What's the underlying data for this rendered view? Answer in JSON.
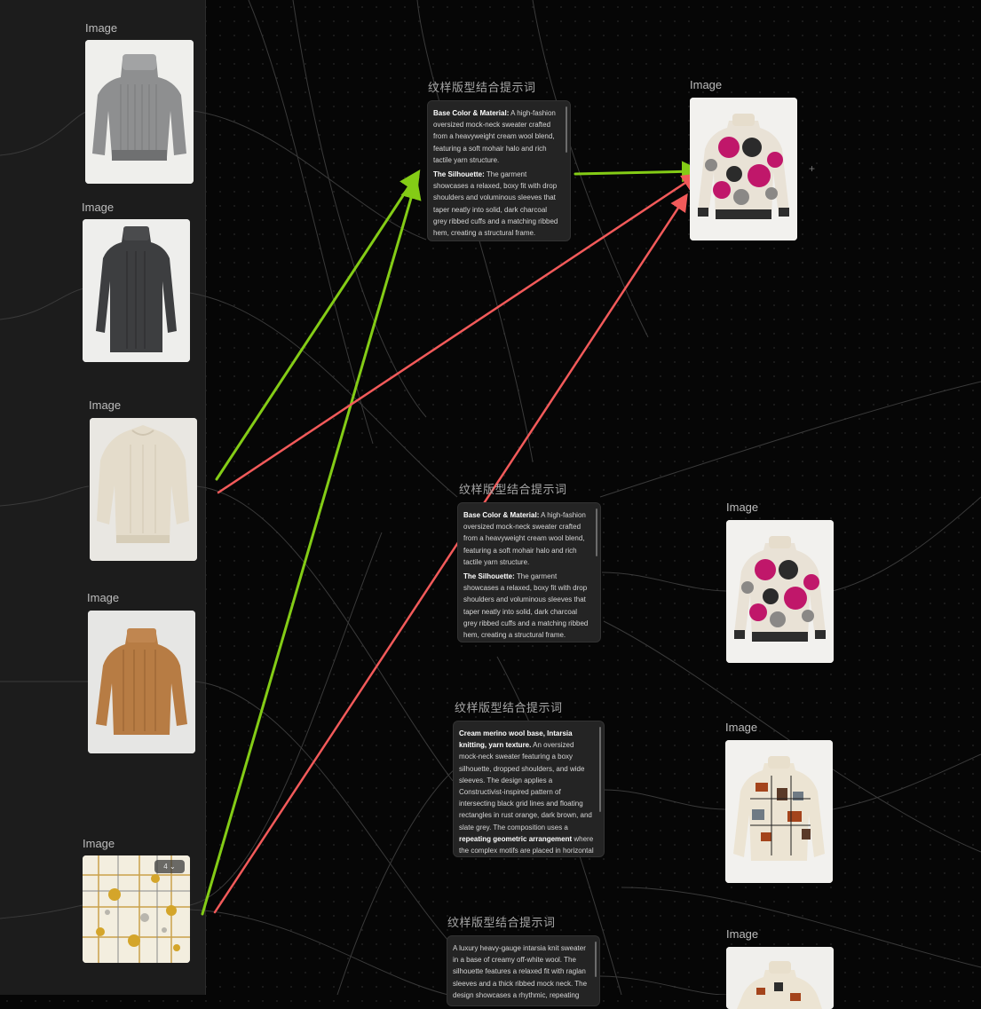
{
  "colors": {
    "canvas_bg": "#060606",
    "panel_bg": "#1c1c1c",
    "edge_gray": "#3a3a3a",
    "arrow_green": "#84cc16",
    "arrow_red": "#f25a5a",
    "accent_magenta": "#c0176a"
  },
  "left_images": [
    {
      "label": "Image",
      "subject": "gray chunky rib-knit turtleneck sweater"
    },
    {
      "label": "Image",
      "subject": "charcoal cable-knit sweater dress"
    },
    {
      "label": "Image",
      "subject": "cream oversized balloon-sleeve sweater"
    },
    {
      "label": "Image",
      "subject": "camel chunky knit mock-neck sweater"
    },
    {
      "label": "Image",
      "subject": "abstract geometric pattern swatch",
      "badge": "4"
    }
  ],
  "prompt_nodes": [
    {
      "label": "纹样版型结合提示词",
      "paragraphs": [
        {
          "bold": "Base Color & Material:",
          "text": " A high-fashion oversized mock-neck sweater crafted from a heavyweight cream wool blend, featuring a soft mohair halo and rich tactile yarn structure."
        },
        {
          "bold": "The Silhouette:",
          "text": " The garment showcases a relaxed, boxy fit with drop shoulders and voluminous sleeves that taper neatly into solid, dark charcoal grey ribbed cuffs and a matching ribbed hem, creating a structural frame."
        }
      ]
    },
    {
      "label": "纹样版型结合提示词",
      "paragraphs": [
        {
          "bold": "Base Color & Material:",
          "text": " A high-fashion oversized mock-neck sweater crafted from a heavyweight cream wool blend, featuring a soft mohair halo and rich tactile yarn structure."
        },
        {
          "bold": "The Silhouette:",
          "text": " The garment showcases a relaxed, boxy fit with drop shoulders and voluminous sleeves that taper neatly into solid, dark charcoal grey ribbed cuffs and a matching ribbed hem, creating a structural frame."
        }
      ]
    },
    {
      "label": "纹样版型结合提示词",
      "paragraphs": [
        {
          "bold": "Cream merino wool base, Intarsia knitting, yarn texture.",
          "text": " An oversized mock-neck sweater featuring a boxy silhouette, dropped shoulders, and wide sleeves. The design applies a Constructivist-inspired pattern of intersecting black grid lines and floating rectangles in rust orange, dark brown, and slate grey. The composition uses a ",
          "bold2": "repeating geometric arrangement",
          "text2": " where the complex motifs are placed in horizontal bands across the torso, separated"
        }
      ]
    },
    {
      "label": "纹样版型结合提示词",
      "paragraphs": [
        {
          "text": "A luxury heavy-gauge intarsia knit sweater in a base of creamy off-white wool. The silhouette features a relaxed fit with raglan sleeves and a thick ribbed mock neck. The design showcases a rhythmic, repeating"
        }
      ]
    }
  ],
  "output_images": [
    {
      "label": "Image",
      "subject": "generated polka-dot intarsia sweater"
    },
    {
      "label": "Image",
      "subject": "generated polka-dot intarsia sweater"
    },
    {
      "label": "Image",
      "subject": "generated geometric grid intarsia sweater"
    },
    {
      "label": "Image",
      "subject": "generated geometric intarsia sweater (partially visible)"
    }
  ],
  "handles": {
    "plus": "+"
  }
}
